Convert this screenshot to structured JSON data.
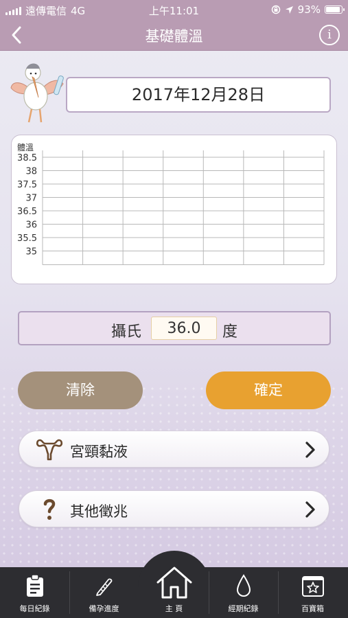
{
  "status_bar": {
    "carrier": "遠傳電信",
    "network": "4G",
    "time": "上午11:01",
    "battery_text": "93%",
    "battery_level": 0.93
  },
  "nav": {
    "title": "基礎體溫",
    "back_icon": "chevron-left-icon",
    "info_icon": "info-icon"
  },
  "date": "2017年12月28日",
  "chart_data": {
    "type": "line",
    "ylabel": "體溫",
    "y_ticks": [
      "38.5",
      "38",
      "37.5",
      "37",
      "36.5",
      "36",
      "35.5",
      "35"
    ],
    "ylim": [
      35,
      38.5
    ],
    "columns": 7,
    "series": [],
    "grid": true
  },
  "temperature": {
    "label_left": "攝氏",
    "value": "36.0",
    "label_right": "度"
  },
  "buttons": {
    "clear": "清除",
    "confirm": "確定"
  },
  "rows": [
    {
      "label": "宮頸黏液",
      "icon": "uterus-icon"
    },
    {
      "label": "其他徵兆",
      "icon": "question-icon"
    }
  ],
  "tabs": [
    {
      "label": "每日紀錄",
      "icon": "clipboard-icon"
    },
    {
      "label": "備孕進度",
      "icon": "pen-icon"
    },
    {
      "label": "主 頁",
      "icon": "home-icon"
    },
    {
      "label": "經期紀錄",
      "icon": "drop-icon"
    },
    {
      "label": "百寶箱",
      "icon": "star-box-icon"
    }
  ],
  "colors": {
    "header": "#b99cb3",
    "clear_button": "#a4917b",
    "confirm_button": "#e8a130",
    "tabbar": "#2d2d31"
  }
}
